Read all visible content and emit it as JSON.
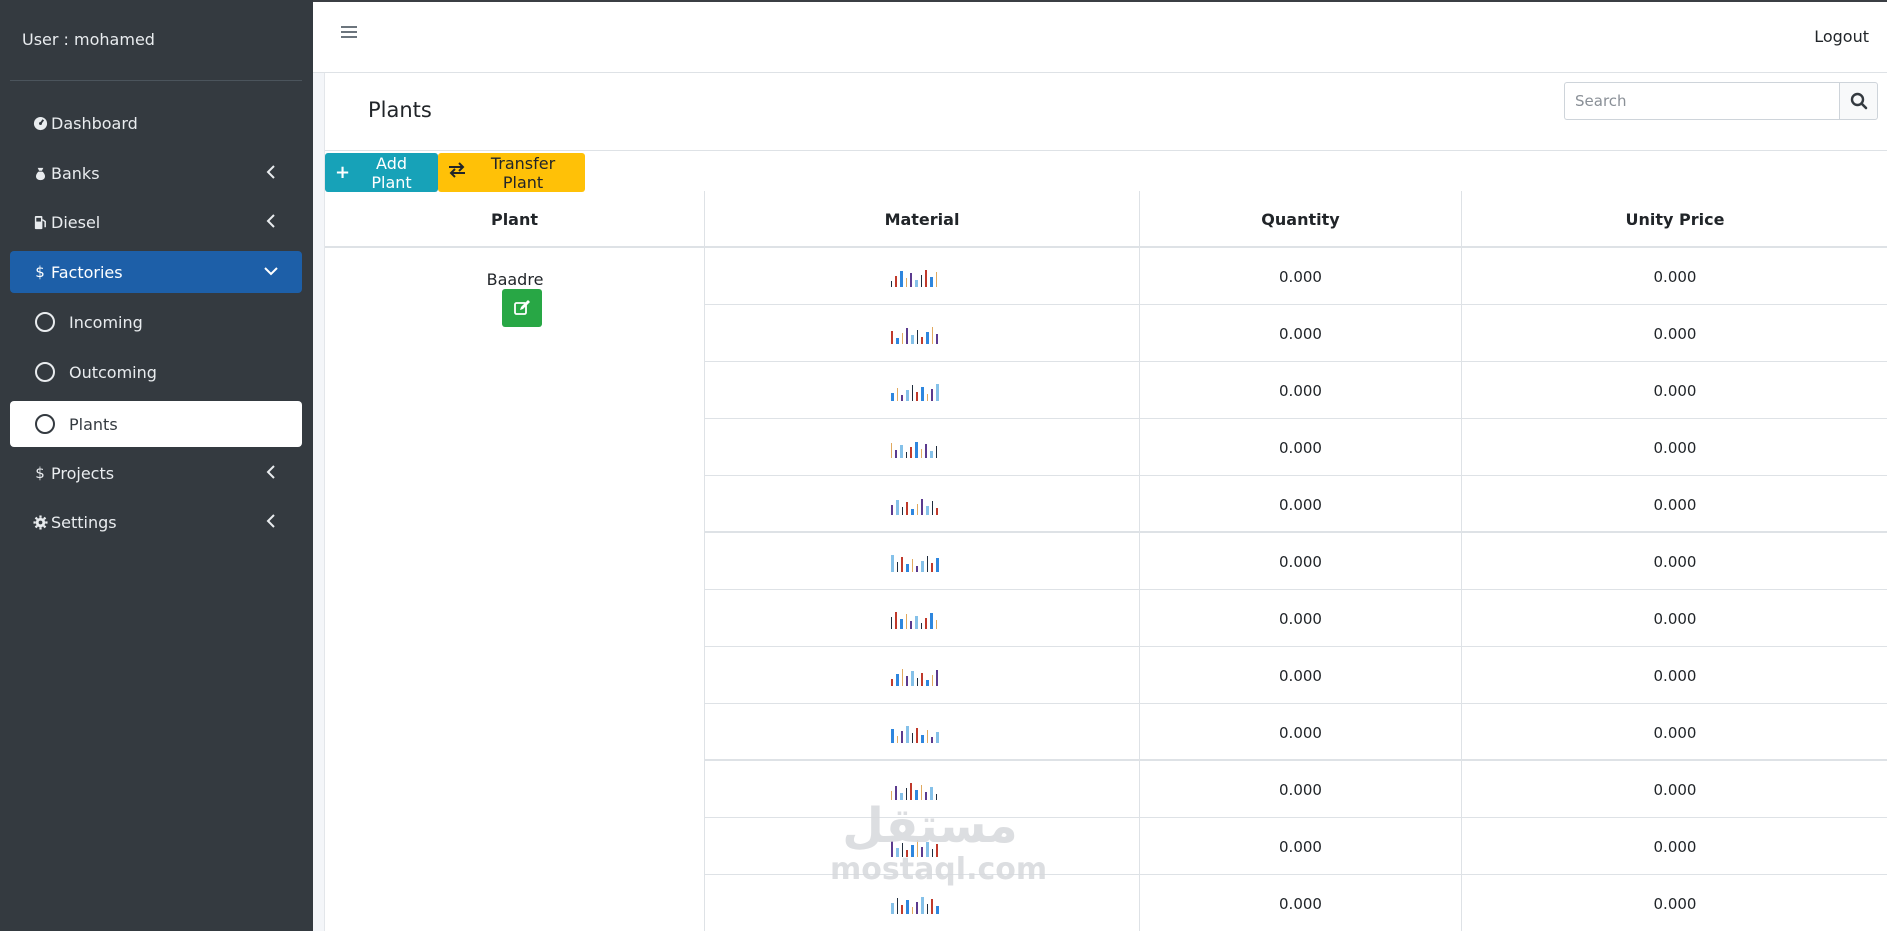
{
  "sidebar": {
    "user": "User : mohamed",
    "items": [
      {
        "label": "Dashboard",
        "icon": "tachometer-icon"
      },
      {
        "label": "Banks",
        "icon": "money-bag-icon"
      },
      {
        "label": "Diesel",
        "icon": "gas-pump-icon"
      },
      {
        "label": "Factories",
        "icon": "dollar-icon"
      },
      {
        "label": "Incoming",
        "icon": "circle-icon"
      },
      {
        "label": "Outcoming",
        "icon": "circle-icon"
      },
      {
        "label": "Plants",
        "icon": "circle-icon"
      },
      {
        "label": "Projects",
        "icon": "dollar-icon"
      },
      {
        "label": "Settings",
        "icon": "gear-icon"
      }
    ]
  },
  "topbar": {
    "logout": "Logout"
  },
  "page": {
    "title": "Plants",
    "search_placeholder": "Search",
    "add_label": "Add Plant",
    "transfer_label": "Transfer Plant"
  },
  "table": {
    "headers": [
      "Plant",
      "Material",
      "Quantity",
      "Unity Price"
    ],
    "plant": "Baadre",
    "rows": [
      {
        "quantity": "0.000",
        "price": "0.000"
      },
      {
        "quantity": "0.000",
        "price": "0.000"
      },
      {
        "quantity": "0.000",
        "price": "0.000"
      },
      {
        "quantity": "0.000",
        "price": "0.000"
      },
      {
        "quantity": "0.000",
        "price": "0.000"
      },
      {
        "quantity": "0.000",
        "price": "0.000"
      },
      {
        "quantity": "0.000",
        "price": "0.000"
      },
      {
        "quantity": "0.000",
        "price": "0.000"
      },
      {
        "quantity": "0.000",
        "price": "0.000"
      },
      {
        "quantity": "0.000",
        "price": "0.000"
      },
      {
        "quantity": "0.000",
        "price": "0.000"
      },
      {
        "quantity": "0.000",
        "price": "0.000"
      }
    ]
  },
  "watermark": {
    "arabic": "مستقل",
    "latin": "mostaql.com"
  },
  "colors": {
    "sidebar_bg": "#343a40",
    "active_bg": "#1d5fa8",
    "add_btn": "#17a2b8",
    "transfer_btn": "#ffc107",
    "edit_btn": "#28a745"
  }
}
